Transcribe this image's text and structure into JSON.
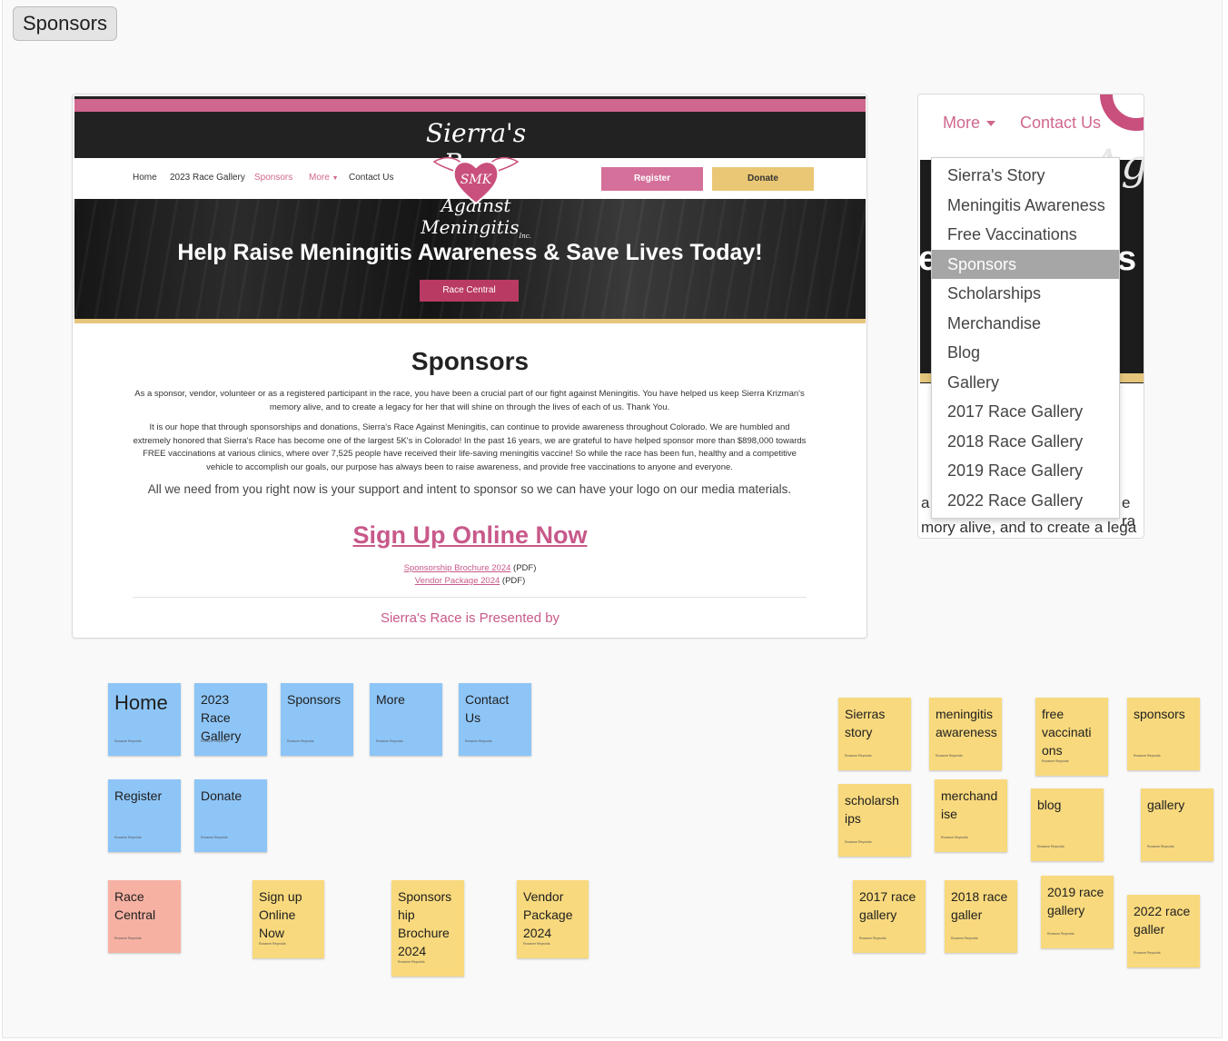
{
  "frame_label": "Sponsors",
  "site": {
    "logo_top": "Sierra's Race",
    "logo_mono": "SMK",
    "logo_bottom": "Against Meningitis",
    "logo_suffix": "Inc.",
    "nav": [
      "Home",
      "2023 Race Gallery",
      "Sponsors",
      "More",
      "Contact Us"
    ],
    "register": "Register",
    "donate": "Donate",
    "hero_title": "Help Raise Meningitis Awareness & Save Lives Today!",
    "race_central": "Race Central",
    "heading": "Sponsors",
    "para1": "As a sponsor, vendor, volunteer or as a registered participant in the race, you have been a crucial part of our fight against Meningitis. You have helped us keep Sierra Krizman's memory alive, and to create a legacy for her that will shine on through the lives of each of us. Thank You.",
    "para2": "It is our hope that through sponsorships and donations, Sierra's Race Against Meningitis, can continue to provide awareness throughout Colorado. We are humbled and extremely honored that Sierra's Race has become one of the largest 5K's in Colorado! In the past 16 years, we are grateful to have helped sponsor more than $898,000 towards FREE vaccinations at various clinics, where over 7,525 people have received their life-saving meningitis vaccine! So while the race has been fun, healthy and a competitive vehicle to accomplish our goals, our purpose has always been to raise awareness, and provide free vaccinations to anyone and everyone.",
    "para3": "All we need from you right now is your support and intent to sponsor so we can have your logo on our media materials.",
    "signup": "Sign Up Online Now",
    "doc1_link": "Sponsorship Brochure 2024",
    "doc1_suffix": "(PDF)",
    "doc2_link": "Vendor Package 2024",
    "doc2_suffix": "(PDF)",
    "presented": "Sierra's Race is Presented by"
  },
  "dropdown": {
    "more": "More",
    "contact": "Contact Us",
    "bg_left_letter": "e",
    "bg_right_letter": "s",
    "bg_script": "Ag",
    "items": [
      "Sierra's Story",
      "Meningitis Awareness",
      "Free Vaccinations",
      "Sponsors",
      "Scholarships",
      "Merchandise",
      "Blog",
      "Gallery",
      "2017 Race Gallery",
      "2018 Race Gallery",
      "2019 Race Gallery",
      "2022 Race Gallery"
    ],
    "active_item": "Sponsors",
    "bottom_left": "a",
    "bottom_right": "e ra",
    "bottom_line": "mory alive, and to create a lega"
  },
  "notes": {
    "author": "Roxanne Reynolds",
    "blue": [
      "Home",
      "2023 Race Gallery",
      "Sponsors",
      "More",
      "Contact Us",
      "Register",
      "Donate"
    ],
    "red": [
      "Race Central"
    ],
    "yellow_left": [
      "Sign up Online Now",
      "Sponsors hip Brochure 2024",
      "Vendor Package 2024"
    ],
    "yellow_right": [
      "Sierras story",
      "meningitis awareness",
      "free vaccinati ons",
      "sponsors",
      "scholarsh ips",
      "merchand ise",
      "blog",
      "gallery",
      "2017 race gallery",
      "2018 race galler",
      "2019 race gallery",
      "2022 race galler"
    ]
  }
}
